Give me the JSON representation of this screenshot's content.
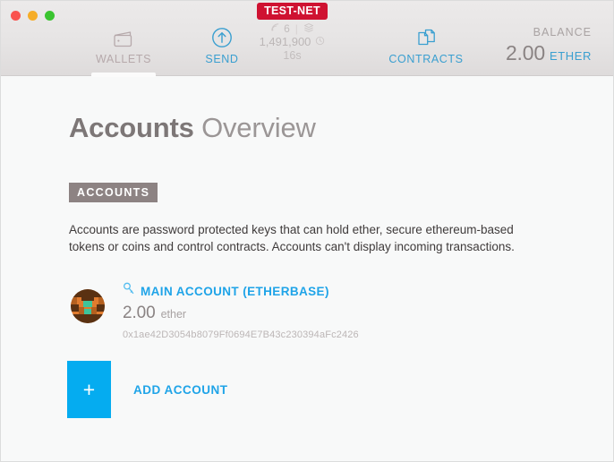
{
  "window": {
    "traffic_lights": [
      {
        "name": "close",
        "color": "#f9524e"
      },
      {
        "name": "minimize",
        "color": "#f6ad27"
      },
      {
        "name": "zoom",
        "color": "#3ac430"
      }
    ]
  },
  "nav": {
    "items": [
      {
        "label": "WALLETS",
        "icon": "wallet-icon",
        "active": true
      },
      {
        "label": "SEND",
        "icon": "send-arrow-icon",
        "active": false
      },
      {
        "label": "CONTRACTS",
        "icon": "contracts-icon",
        "active": false
      }
    ]
  },
  "network": {
    "badge": "TEST-NET",
    "badge_color": "#cf1231",
    "peers": "6",
    "peers_icon": "signal-icon",
    "block_icon": "blocks-icon",
    "block_number": "1,491,900",
    "time_icon": "clock-icon",
    "last_block_time": "16s",
    "divider": "|"
  },
  "balance": {
    "label": "BALANCE",
    "value": "2.00",
    "unit": "ETHER",
    "unit_color": "#3a9fd0"
  },
  "page": {
    "title_strong": "Accounts",
    "title_light": "Overview"
  },
  "accounts_section": {
    "badge": "ACCOUNTS",
    "badge_color": "#8d8383",
    "description": "Accounts are password protected keys that can hold ether, secure ethereum-based tokens or coins and control contracts. Accounts can't display incoming transactions."
  },
  "accounts": [
    {
      "key_icon": "key-icon",
      "name": "MAIN ACCOUNT (ETHERBASE)",
      "name_color": "#1fa4e8",
      "balance": "2.00",
      "balance_unit": "ether",
      "address": "0x1ae42D3054b8079Ff0694E7B43c230394aFc2426",
      "identicon_colors": [
        "#b4601f",
        "#e07b2e",
        "#3ec49a",
        "#5a3112"
      ]
    }
  ],
  "add_account": {
    "plus": "+",
    "label": "ADD ACCOUNT",
    "tile_color": "#05acf0",
    "label_color": "#1fa4e8"
  }
}
